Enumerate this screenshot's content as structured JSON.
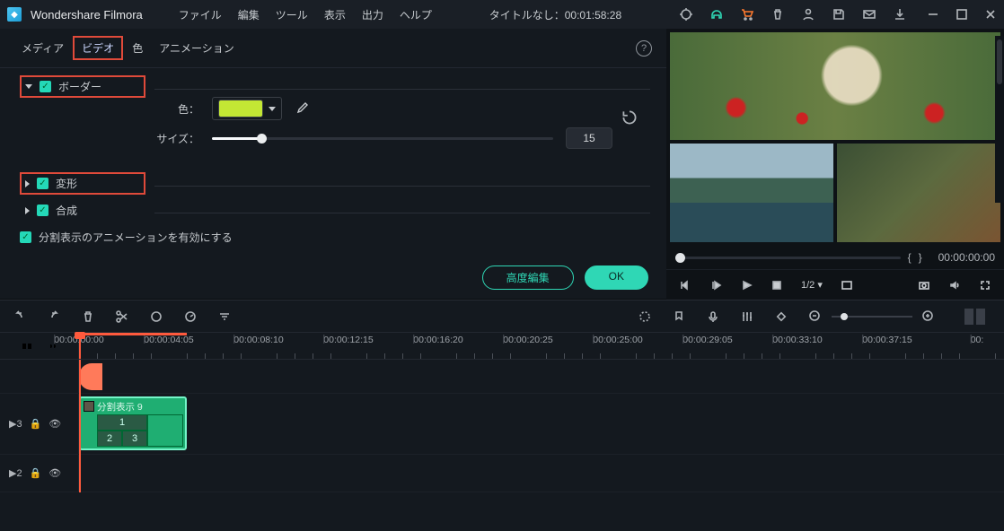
{
  "title": {
    "app": "Wondershare Filmora",
    "doc": "タイトルなし：00:01:58:28"
  },
  "menus": {
    "file": "ファイル",
    "edit": "編集",
    "tool": "ツール",
    "view": "表示",
    "export": "出力",
    "help": "ヘルプ"
  },
  "tabs": {
    "media": "メディア",
    "video": "ビデオ",
    "color": "色",
    "anim": "アニメーション"
  },
  "sections": {
    "border": "ボーダー",
    "transform": "変形",
    "compose": "合成"
  },
  "border": {
    "color_label": "色：",
    "size_label": "サイズ：",
    "size_value": "15",
    "color_hex": "#c3e734"
  },
  "footer_check": "分割表示のアニメーションを有効にする",
  "buttons": {
    "advanced": "高度編集",
    "ok": "OK"
  },
  "preview": {
    "tc": "00:00:00:00",
    "brace_l": "{",
    "brace_r": "}",
    "zoom": "1/2",
    "caret": "▾"
  },
  "timeline_ticks": [
    "00:00:00:00",
    "00:00:04:05",
    "00:00:08:10",
    "00:00:12:15",
    "00:00:16:20",
    "00:00:20:25",
    "00:00:25:00",
    "00:00:29:05",
    "00:00:33:10",
    "00:00:37:15",
    "00:"
  ],
  "tracks": {
    "main": "3",
    "sub": "2"
  },
  "clip": {
    "title": "分割表示 9",
    "c1": "1",
    "c2": "2",
    "c3": "3"
  }
}
